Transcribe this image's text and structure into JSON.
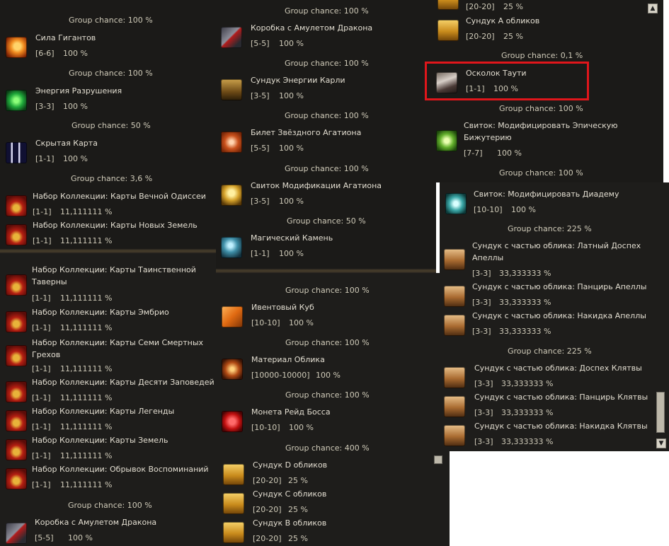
{
  "panel1": {
    "entries": [
      {
        "type": "gc",
        "text": "Group chance: 100 %"
      },
      {
        "type": "item",
        "name": "Сила Гигантов",
        "count": "[6-6]",
        "pct": "100 %",
        "icon": "fire-orb-icon"
      },
      {
        "type": "gc",
        "text": "Group chance: 100 %"
      },
      {
        "type": "item",
        "name": "Энергия Разрушения",
        "count": "[3-3]",
        "pct": "100 %",
        "icon": "green-crystal-icon"
      },
      {
        "type": "gc",
        "text": "Group chance: 50 %"
      },
      {
        "type": "item",
        "name": "Скрытая Карта",
        "count": "[1-1]",
        "pct": "100 %",
        "icon": "hidden-card-icon"
      },
      {
        "type": "gc",
        "text": "Group chance: 3,6 %"
      },
      {
        "type": "item",
        "name": "Набор Коллекции: Карты Вечной Одиссеи",
        "count": "[1-1]",
        "pct": "11,111111 %",
        "icon": "collection-bag-icon"
      },
      {
        "type": "item",
        "name": "Набор Коллекции: Карты Новых Земель",
        "count": "[1-1]",
        "pct": "11,111111 %",
        "icon": "collection-bag-icon"
      }
    ]
  },
  "panel2": {
    "entries": [
      {
        "type": "item",
        "name": "Набор Коллекции: Карты Таинственной",
        "name2": "Таверны",
        "count": "[1-1]",
        "pct": "11,111111 %",
        "icon": "collection-bag-icon"
      },
      {
        "type": "item",
        "name": "Набор Коллекции: Карты Эмбрио",
        "count": "[1-1]",
        "pct": "11,111111 %",
        "icon": "collection-bag-icon"
      },
      {
        "type": "item",
        "name": "Набор Коллекции: Карты Семи Смертных",
        "name2": "Грехов",
        "count": "[1-1]",
        "pct": "11,111111 %",
        "icon": "collection-bag-icon"
      },
      {
        "type": "item",
        "name": "Набор Коллекции: Карты Десяти Заповедей",
        "count": "[1-1]",
        "pct": "11,111111 %",
        "icon": "collection-bag-icon"
      },
      {
        "type": "item",
        "name": "Набор Коллекции: Карты Легенды",
        "count": "[1-1]",
        "pct": "11,111111 %",
        "icon": "collection-bag-icon"
      },
      {
        "type": "item",
        "name": "Набор Коллекции: Карты Земель",
        "count": "[1-1]",
        "pct": "11,111111 %",
        "icon": "collection-bag-icon"
      },
      {
        "type": "item",
        "name": "Набор Коллекции: Обрывок Воспоминаний",
        "count": "[1-1]",
        "pct": "11,111111 %",
        "icon": "collection-bag-icon"
      },
      {
        "type": "gc",
        "text": "Group chance: 100 %"
      },
      {
        "type": "item",
        "name": "Коробка с Амулетом Дракона",
        "count": "[5-5]",
        "pct": "100 %",
        "icon": "dragon-amulet-box-icon"
      }
    ]
  },
  "panel3": {
    "entries": [
      {
        "type": "gc",
        "text": "Group chance: 100 %"
      },
      {
        "type": "item",
        "name": "Коробка с Амулетом Дракона",
        "count": "[5-5]",
        "pct": "100 %",
        "icon": "dragon-amulet-box-icon"
      },
      {
        "type": "gc",
        "text": "Group chance: 100 %"
      },
      {
        "type": "item",
        "name": "Сундук Энергии Карли",
        "count": "[3-5]",
        "pct": "100 %",
        "icon": "karli-chest-icon"
      },
      {
        "type": "gc",
        "text": "Group chance: 100 %"
      },
      {
        "type": "item",
        "name": "Билет Звёздного Агатиона",
        "count": "[5-5]",
        "pct": "100 %",
        "icon": "agathion-ticket-icon"
      },
      {
        "type": "gc",
        "text": "Group chance: 100 %"
      },
      {
        "type": "item",
        "name": "Свиток Модификации Агатиона",
        "count": "[3-5]",
        "pct": "100 %",
        "icon": "agathion-scroll-icon"
      },
      {
        "type": "gc",
        "text": "Group chance: 50 %"
      },
      {
        "type": "item",
        "name": "Магический Камень",
        "count": "[1-1]",
        "pct": "100 %",
        "icon": "magic-stone-icon"
      }
    ]
  },
  "panel4": {
    "entries": [
      {
        "type": "gc",
        "text": "Group chance: 100 %"
      },
      {
        "type": "item",
        "name": "Ивентовый Куб",
        "count": "[10-10]",
        "pct": "100 %",
        "icon": "event-cube-icon"
      },
      {
        "type": "gc",
        "text": "Group chance: 100 %"
      },
      {
        "type": "item",
        "name": "Материал Облика",
        "count": "[10000-10000]",
        "pct": "100 %",
        "icon": "appearance-material-icon"
      },
      {
        "type": "gc",
        "text": "Group chance: 100 %"
      },
      {
        "type": "item",
        "name": "Монета Рейд Босса",
        "count": "[10-10]",
        "pct": "100 %",
        "icon": "raid-boss-coin-icon"
      },
      {
        "type": "gc",
        "text": "Group chance: 400 %"
      },
      {
        "type": "item",
        "name": "Сундук D обликов",
        "count": "[20-20]",
        "pct": "25 %",
        "icon": "golden-chest-icon"
      },
      {
        "type": "item",
        "name": "Сундук C обликов",
        "count": "[20-20]",
        "pct": "25 %",
        "icon": "golden-chest-icon"
      },
      {
        "type": "item",
        "name": "Сундук B обликов",
        "count": "[20-20]",
        "pct": "25 %",
        "icon": "golden-chest-icon"
      }
    ]
  },
  "panel5": {
    "top_partial": {
      "count": "[20-20]",
      "pct": "25 %"
    },
    "entries": [
      {
        "type": "item",
        "name": "Сундук A обликов",
        "count": "[20-20]",
        "pct": "25 %",
        "icon": "golden-chest-icon"
      },
      {
        "type": "gc",
        "text": "Group chance: 0,1 %"
      },
      {
        "type": "item",
        "name": "Осколок Таути",
        "count": "[1-1]",
        "pct": "100 %",
        "icon": "tauti-shard-icon",
        "highlight": true
      },
      {
        "type": "gc",
        "text": "Group chance: 100 %"
      },
      {
        "type": "item",
        "name": "Свиток: Модифицировать Эпическую",
        "name2": "Бижутерию",
        "count": "[7-7]",
        "pct": "100 %",
        "icon": "epic-jewelry-scroll-icon"
      },
      {
        "type": "gc",
        "text": "Group chance: 100 %"
      }
    ]
  },
  "panel6": {
    "entries": [
      {
        "type": "item",
        "name": "Свиток: Модифицировать Диадему",
        "count": "[10-10]",
        "pct": "100 %",
        "icon": "diadem-scroll-icon"
      },
      {
        "type": "gc",
        "text": "Group chance: 225 %"
      },
      {
        "type": "item",
        "name": "Сундук с частью облика: Латный Доспех",
        "name2": "Апеллы",
        "count": "[3-3]",
        "pct": "33,333333 %",
        "icon": "appearance-chest-icon"
      },
      {
        "type": "item",
        "name": "Сундук с частью облика: Панцирь Апеллы",
        "count": "[3-3]",
        "pct": "33,333333 %",
        "icon": "appearance-chest-icon"
      },
      {
        "type": "item",
        "name": "Сундук с частью облика: Накидка Апеллы",
        "count": "[3-3]",
        "pct": "33,333333 %",
        "icon": "appearance-chest-icon"
      },
      {
        "type": "gc",
        "text": "Group chance: 225 %"
      },
      {
        "type": "item",
        "name": "Сундук с частью облика: Доспех Клятвы",
        "count": "[3-3]",
        "pct": "33,333333 %",
        "icon": "appearance-chest-icon"
      },
      {
        "type": "item",
        "name": "Сундук с частью облика: Панцирь Клятвы",
        "count": "[3-3]",
        "pct": "33,333333 %",
        "icon": "appearance-chest-icon"
      },
      {
        "type": "item",
        "name": "Сундук с частью облика: Накидка Клятвы",
        "count": "[3-3]",
        "pct": "33,333333 %",
        "icon": "appearance-chest-icon"
      }
    ]
  },
  "scroll": {
    "up": "▲",
    "down": "▼"
  }
}
